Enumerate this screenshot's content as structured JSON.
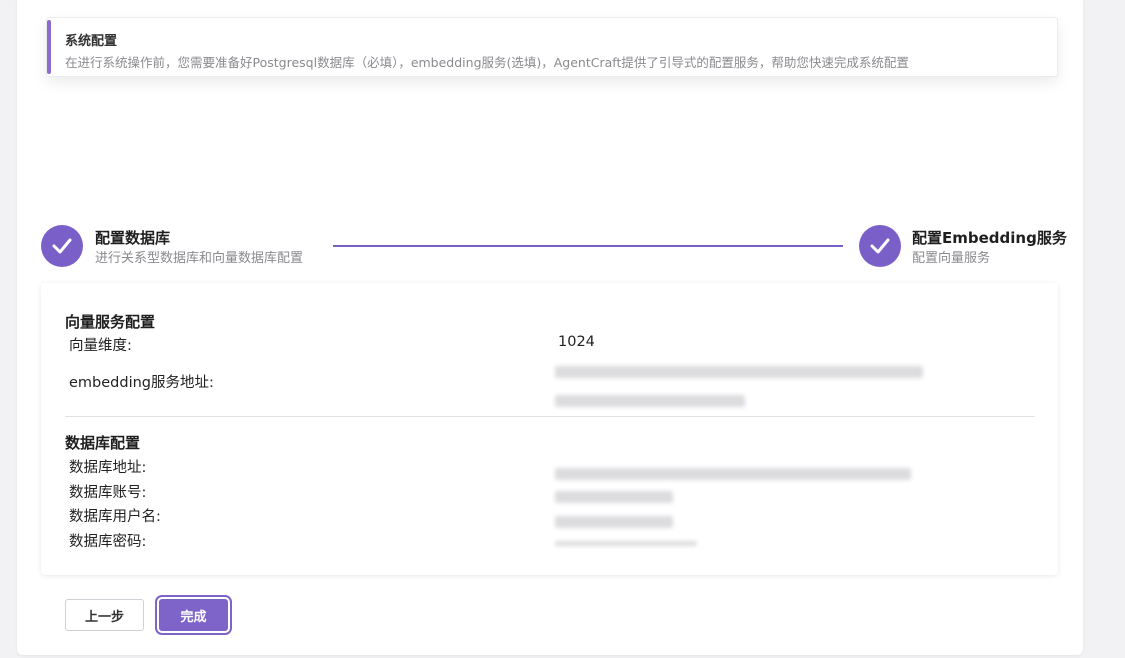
{
  "alert": {
    "title": "系统配置",
    "description": "在进行系统操作前，您需要准备好Postgresql数据库（必填），embedding服务(选填)，AgentCraft提供了引导式的配置服务，帮助您快速完成系统配置"
  },
  "steps": [
    {
      "title": "配置数据库",
      "subtitle": "进行关系型数据库和向量数据库配置",
      "status": "finished",
      "icon": "check-icon"
    },
    {
      "title": "配置Embedding服务",
      "subtitle": "配置向量服务",
      "status": "finished",
      "icon": "check-icon"
    }
  ],
  "vector_section": {
    "title": "向量服务配置",
    "fields": [
      {
        "label": "向量维度:",
        "value": "1024"
      },
      {
        "label": "embedding服务地址:",
        "value": ""
      }
    ]
  },
  "db_section": {
    "title": "数据库配置",
    "fields": [
      {
        "label": "数据库地址:",
        "value": ""
      },
      {
        "label": "数据库账号:",
        "value": ""
      },
      {
        "label": "数据库用户名:",
        "value": ""
      },
      {
        "label": "数据库密码:",
        "value": ""
      }
    ]
  },
  "buttons": {
    "prev": "上一步",
    "done": "完成"
  },
  "colors": {
    "accent": "#7b5fc9",
    "muted_text": "#8a8a8f"
  }
}
